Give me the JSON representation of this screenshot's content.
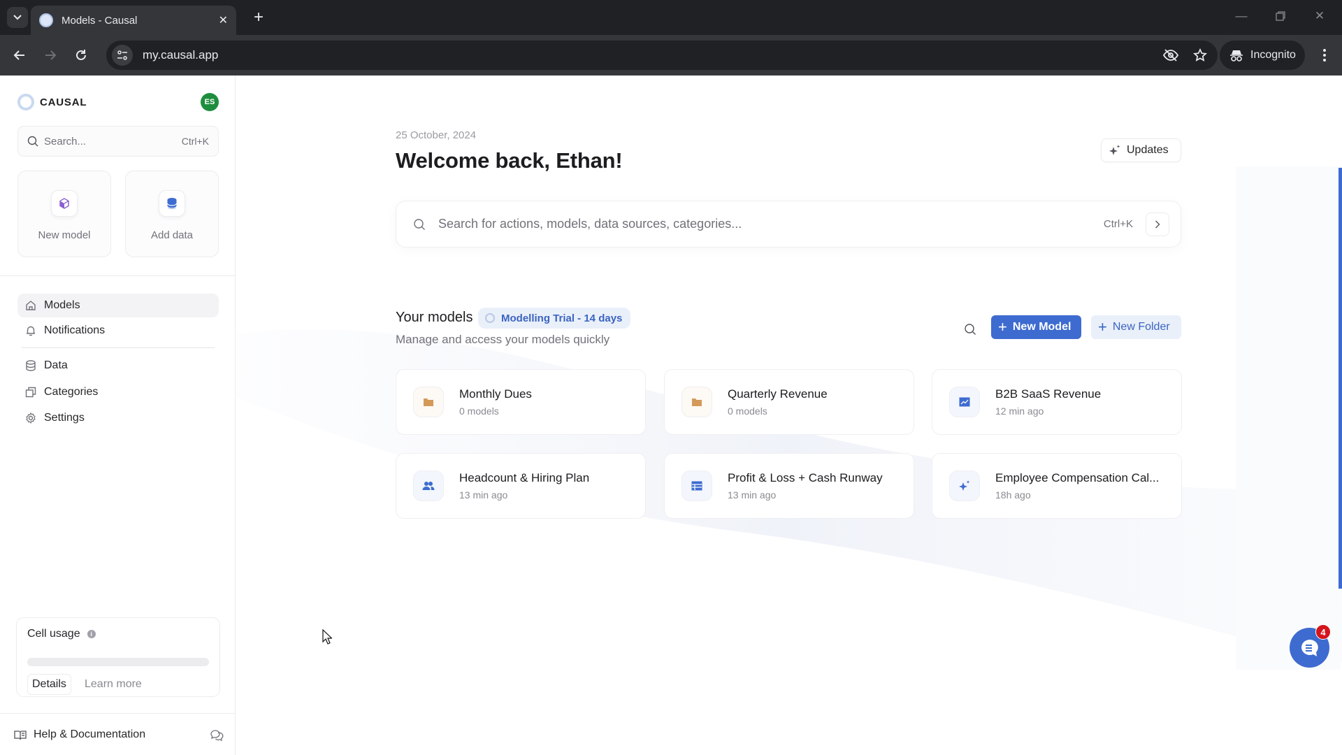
{
  "browser": {
    "tab_title": "Models - Causal",
    "url": "my.causal.app",
    "incognito_label": "Incognito"
  },
  "sidebar": {
    "brand": "CAUSAL",
    "avatar_initials": "ES",
    "avatar_color": "#1e8e3e",
    "search_placeholder": "Search...",
    "search_shortcut": "Ctrl+K",
    "quick_actions": [
      {
        "label": "New model",
        "icon": "cube-icon"
      },
      {
        "label": "Add data",
        "icon": "database-icon"
      }
    ],
    "nav": [
      {
        "label": "Models",
        "icon": "home-icon",
        "active": true
      },
      {
        "label": "Notifications",
        "icon": "bell-icon",
        "active": false
      },
      {
        "label": "Data",
        "icon": "database-icon",
        "active": false
      },
      {
        "label": "Categories",
        "icon": "stack-icon",
        "active": false
      },
      {
        "label": "Settings",
        "icon": "gear-icon",
        "active": false
      }
    ],
    "cell_usage": {
      "title": "Cell usage",
      "info_icon": "i",
      "progress_fraction": 0.0,
      "details_label": "Details",
      "learn_more_label": "Learn more"
    },
    "help_label": "Help & Documentation"
  },
  "main": {
    "date": "25 October, 2024",
    "welcome": "Welcome back, Ethan!",
    "updates_label": "Updates",
    "search_placeholder": "Search for actions, models, data sources, categories...",
    "search_shortcut": "Ctrl+K",
    "models_title": "Your models",
    "trial_badge": "Modelling Trial - 14 days",
    "models_subtitle": "Manage and access your models quickly",
    "new_model_label": "New Model",
    "new_folder_label": "New Folder",
    "accent_color": "#3d6bd0",
    "models": [
      {
        "name": "Monthly Dues",
        "meta": "0 models",
        "kind": "folder",
        "icon": "folder-icon"
      },
      {
        "name": "Quarterly Revenue",
        "meta": "0 models",
        "kind": "folder",
        "icon": "folder-icon"
      },
      {
        "name": "B2B SaaS Revenue",
        "meta": "12 min ago",
        "kind": "model",
        "icon": "chart-line-icon"
      },
      {
        "name": "Headcount & Hiring Plan",
        "meta": "13 min ago",
        "kind": "model",
        "icon": "users-icon"
      },
      {
        "name": "Profit & Loss + Cash Runway",
        "meta": "13 min ago",
        "kind": "model",
        "icon": "table-icon"
      },
      {
        "name": "Employee Compensation Cal...",
        "meta": "18h ago",
        "kind": "model",
        "icon": "sparkle-icon"
      }
    ]
  },
  "chat": {
    "unread_count": "4"
  }
}
